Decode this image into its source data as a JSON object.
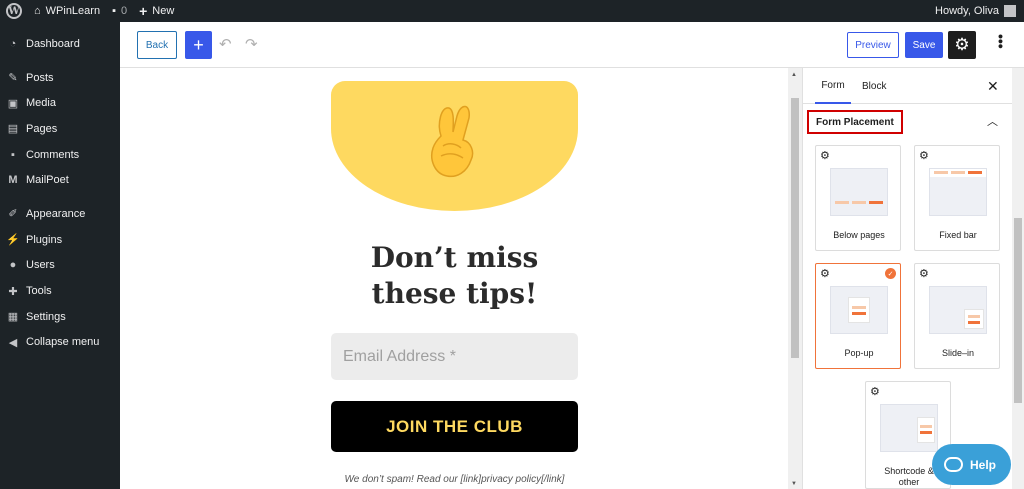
{
  "admin_bar": {
    "site_name": "WPinLearn",
    "comments_count": "0",
    "new_label": "New",
    "greeting": "Howdy, Oliva"
  },
  "sidebar": {
    "items": [
      {
        "label": "Dashboard",
        "icon": "dashboard-icon"
      },
      {
        "label": "Posts",
        "icon": "pin-icon"
      },
      {
        "label": "Media",
        "icon": "media-icon"
      },
      {
        "label": "Pages",
        "icon": "pages-icon"
      },
      {
        "label": "Comments",
        "icon": "comment-icon"
      },
      {
        "label": "MailPoet",
        "icon": "mailpoet-icon"
      },
      {
        "label": "Appearance",
        "icon": "brush-icon"
      },
      {
        "label": "Plugins",
        "icon": "plug-icon"
      },
      {
        "label": "Users",
        "icon": "user-icon"
      },
      {
        "label": "Tools",
        "icon": "wrench-icon"
      },
      {
        "label": "Settings",
        "icon": "settings-icon"
      },
      {
        "label": "Collapse menu",
        "icon": "collapse-icon"
      }
    ]
  },
  "toolbar": {
    "back_label": "Back",
    "add_label": "+",
    "preview_label": "Preview",
    "save_label": "Save"
  },
  "form_preview": {
    "headline_line1": "Don’t miss",
    "headline_line2": "these tips!",
    "email_placeholder": "Email Address *",
    "button_label": "JOIN THE CLUB",
    "disclaimer": "We don’t spam! Read our [link]privacy policy[/link]",
    "accent_color": "#fed960"
  },
  "panel": {
    "tabs": [
      {
        "label": "Form",
        "active": true
      },
      {
        "label": "Block",
        "active": false
      }
    ],
    "section_title": "Form Placement",
    "options": [
      {
        "label": "Below pages",
        "selected": false
      },
      {
        "label": "Fixed bar",
        "selected": false
      },
      {
        "label": "Pop-up",
        "selected": true
      },
      {
        "label": "Slide–in",
        "selected": false
      },
      {
        "label": "Shortcode & other",
        "selected": false
      }
    ],
    "accent_color": "#f0733a"
  },
  "help": {
    "label": "Help"
  }
}
